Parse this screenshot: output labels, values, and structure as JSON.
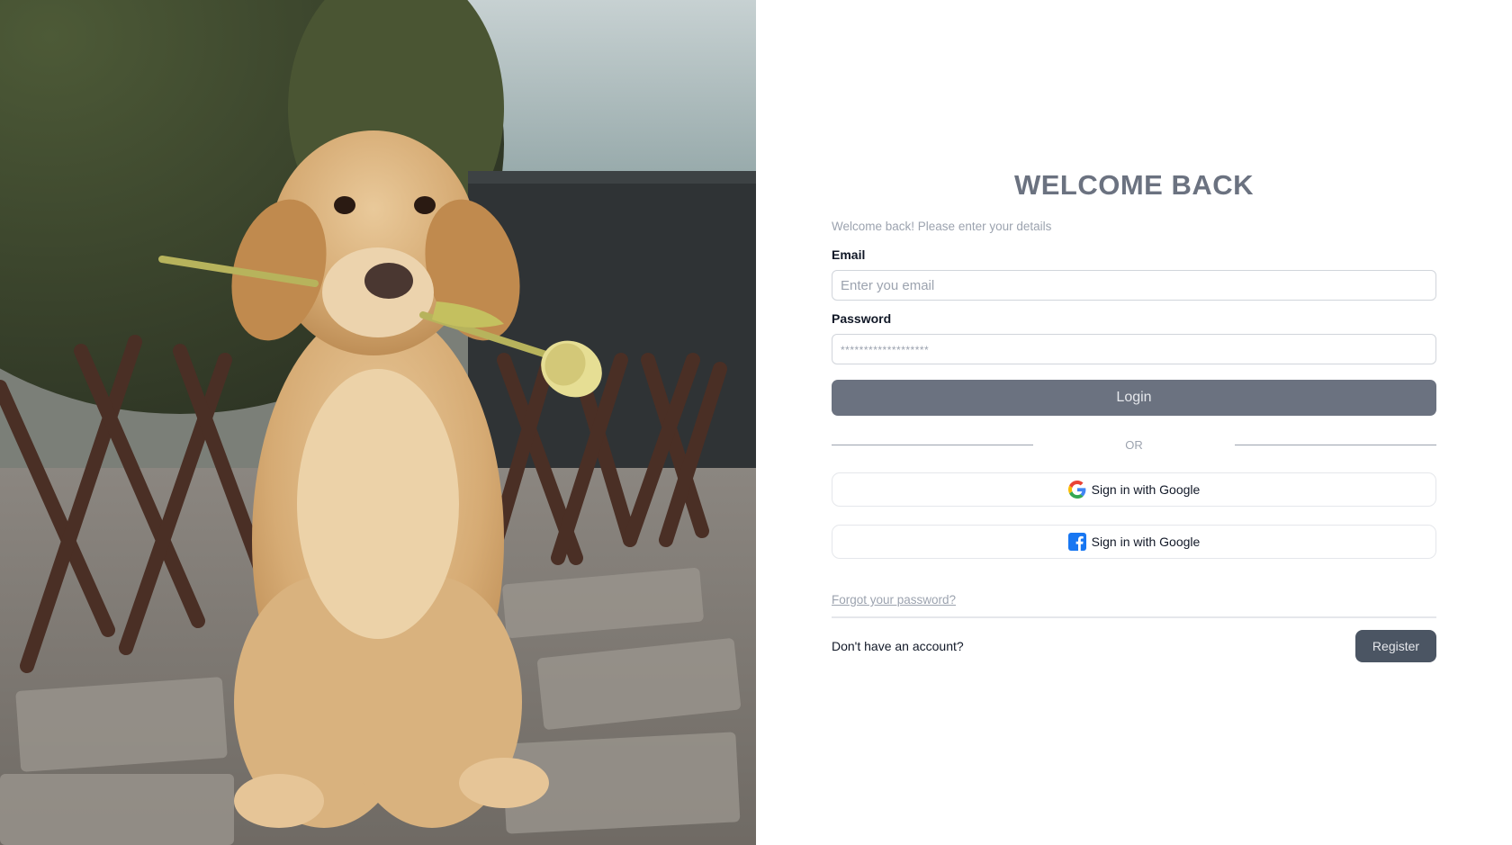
{
  "hero": {
    "image": "golden-retriever-puppy-holding-tulip"
  },
  "form": {
    "title": "WELCOME BACK",
    "subtitle": "Welcome back! Please enter your details",
    "email": {
      "label": "Email",
      "placeholder": "Enter you email",
      "value": ""
    },
    "password": {
      "label": "Password",
      "placeholder": "*******************",
      "value": ""
    },
    "login_label": "Login",
    "or_label": "OR",
    "google": {
      "label": "Sign in with Google",
      "icon": "google-icon"
    },
    "facebook": {
      "label": "Sign in with Google",
      "icon": "facebook-icon"
    },
    "forgot_label": "Forgot your password?",
    "no_account_label": "Don't have an account?",
    "register_label": "Register"
  },
  "colors": {
    "primary_button": "#6b7280",
    "register_button": "#4b5563",
    "title": "#6b7280",
    "muted_text": "#9ca3af",
    "facebook_blue": "#1877f2"
  }
}
